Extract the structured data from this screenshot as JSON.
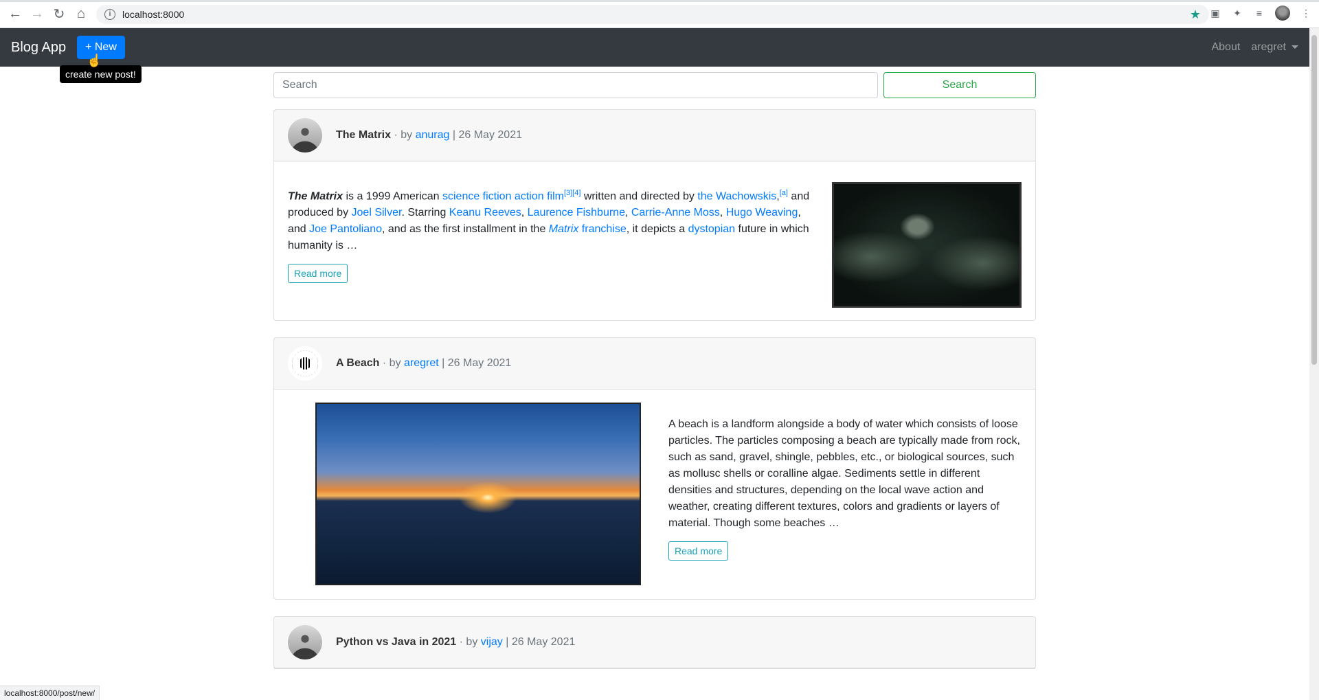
{
  "browser": {
    "url": "localhost:8000",
    "status_url": "localhost:8000/post/new/"
  },
  "navbar": {
    "brand": "Blog App",
    "new_label": "+ New",
    "tooltip": "create new post!",
    "about": "About",
    "user": "aregret"
  },
  "search": {
    "placeholder": "Search",
    "button": "Search"
  },
  "posts": [
    {
      "title": "The Matrix",
      "by": "· by",
      "author": "anurag",
      "date": "| 26 May 2021",
      "read_more": "Read more"
    },
    {
      "title": "A Beach",
      "by": "· by",
      "author": "aregret",
      "date": "| 26 May 2021",
      "body": "A beach is a landform alongside a body of water which consists of loose particles. The particles composing a beach are typically made from rock, such as sand, gravel, shingle, pebbles, etc., or biological sources, such as mollusc shells or coralline algae. Sediments settle in different densities and structures, depending on the local wave action and weather, creating different textures, colors and gradients or layers of material. Though some beaches …",
      "read_more": "Read more"
    },
    {
      "title": "Python vs Java in 2021",
      "by": "· by",
      "author": "vijay",
      "date": "| 26 May 2021"
    }
  ],
  "matrix_text": {
    "t1": "The Matrix",
    "t2": " is a 1999 American ",
    "l1": "science fiction action film",
    "s1": "[3][4]",
    "t3": " written and directed by ",
    "l2": "the Wachowskis",
    "t3b": ",",
    "s2": "[a]",
    "t4": " and produced by ",
    "l3": "Joel Silver",
    "t5": ". Starring ",
    "l4": "Keanu Reeves",
    "c1": ", ",
    "l5": "Laurence Fishburne",
    "c2": ", ",
    "l6": "Carrie-Anne Moss",
    "c3": ", ",
    "l7": "Hugo Weaving",
    "t6": ", and ",
    "l8": "Joe Pantoliano",
    "t7": ", and as the first installment in the ",
    "l9": "Matrix",
    "l10": " franchise",
    "t8": ", it depicts a ",
    "l11": "dystopian",
    "t9": " future in which humanity is …"
  }
}
